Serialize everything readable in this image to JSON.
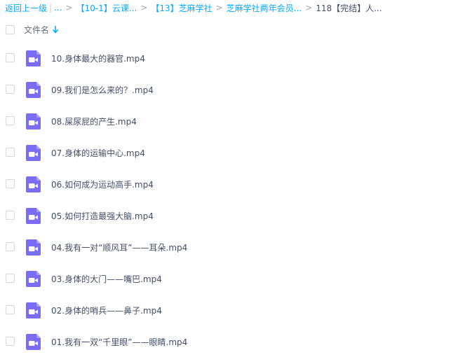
{
  "breadcrumb": {
    "back": "返回上一级",
    "pipe": "|",
    "ellipsis": "...",
    "sep": ">",
    "items": [
      "【10-1】云课...",
      "【13】芝麻学社",
      "芝麻学社两年会员..."
    ],
    "current": "118【完结】人..."
  },
  "header": {
    "column_label": "文件名"
  },
  "files": [
    {
      "name": "10.身体最大的器官.mp4"
    },
    {
      "name": "09.我们是怎么来的？.mp4"
    },
    {
      "name": "08.屎尿屁的产生.mp4"
    },
    {
      "name": "07.身体的运输中心.mp4"
    },
    {
      "name": "06.如何成为运动高手.mp4"
    },
    {
      "name": "05.如何打造最强大脑.mp4"
    },
    {
      "name": "04.我有一对“顺风耳”——耳朵.mp4"
    },
    {
      "name": "03.身体的大门——嘴巴.mp4"
    },
    {
      "name": "02.身体的哨兵——鼻子.mp4"
    },
    {
      "name": "01.我有一双“千里眼”——眼睛.mp4"
    }
  ],
  "colors": {
    "link": "#09aaff",
    "video_icon": "#7b6cf6",
    "text": "#424e67"
  },
  "icons": {
    "file": "video-file-icon",
    "sort": "sort-down-arrow-icon"
  }
}
